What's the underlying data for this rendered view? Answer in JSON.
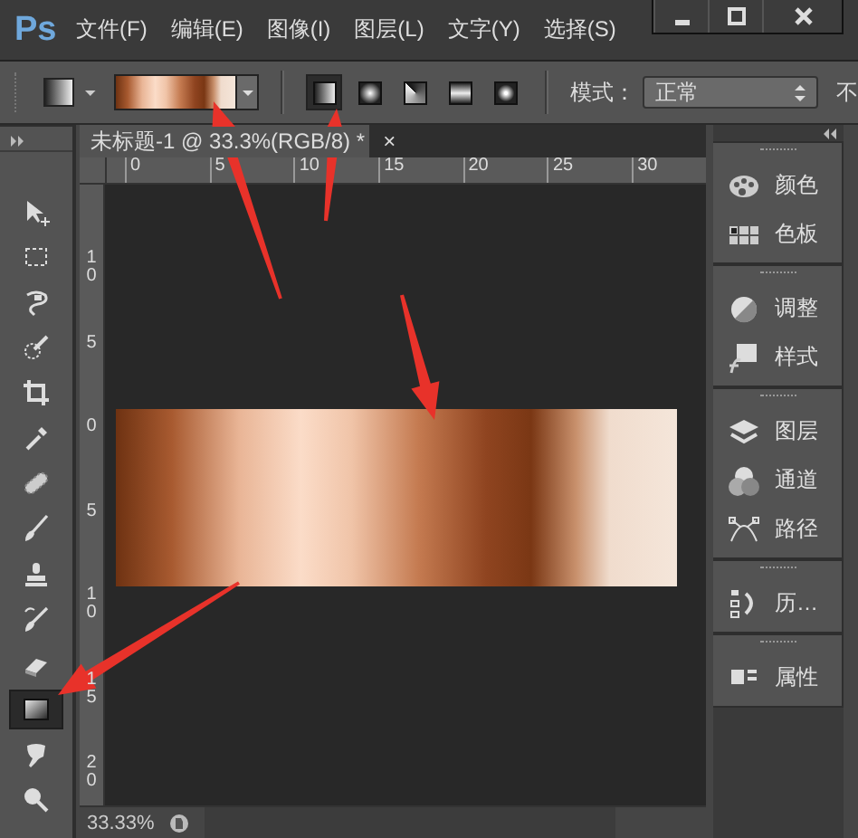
{
  "menu_bar": {
    "logo": "Ps",
    "items": [
      "文件(F)",
      "编辑(E)",
      "图像(I)",
      "图层(L)",
      "文字(Y)",
      "选择(S)"
    ]
  },
  "options_bar": {
    "gradient_types": [
      {
        "selected": true
      },
      {
        "selected": false
      },
      {
        "selected": false
      },
      {
        "selected": false
      },
      {
        "selected": false
      }
    ],
    "mode_label": "模式：",
    "mode_value": "正常",
    "cut_label": "不"
  },
  "tools": [
    {
      "selected": false
    },
    {
      "selected": false
    },
    {
      "selected": false
    },
    {
      "selected": false
    },
    {
      "selected": false
    },
    {
      "selected": false
    },
    {
      "selected": false
    },
    {
      "selected": false
    },
    {
      "selected": false
    },
    {
      "selected": false
    },
    {
      "selected": false
    },
    {
      "selected": true
    },
    {
      "selected": false
    },
    {
      "selected": false
    }
  ],
  "document": {
    "tab_title": "未标题-1 @ 33.3%(RGB/8) *",
    "tab_close": "×",
    "top_ruler": [
      "0",
      "5",
      "10",
      "15",
      "20",
      "25",
      "30"
    ],
    "left_ruler": [
      "10",
      "5",
      "0",
      "5",
      "10",
      "15",
      "20"
    ]
  },
  "panels": [
    {
      "items": [
        "颜色",
        "色板"
      ]
    },
    {
      "items": [
        "调整",
        "样式"
      ]
    },
    {
      "items": [
        "图层",
        "通道",
        "路径"
      ]
    },
    {
      "items": [
        "历…"
      ]
    },
    {
      "items": [
        "属性"
      ]
    }
  ],
  "status_bar": {
    "zoom": "33.33%"
  }
}
